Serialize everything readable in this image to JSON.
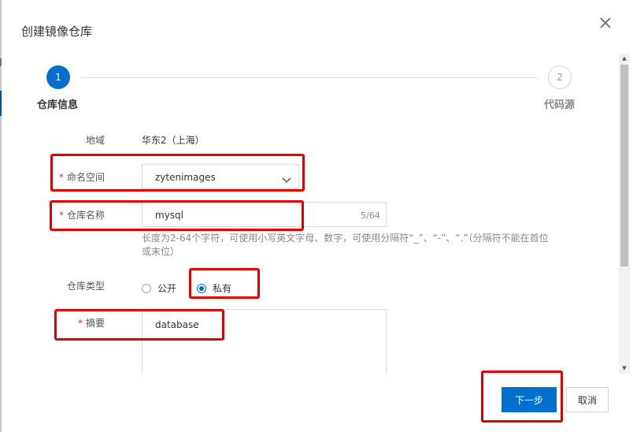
{
  "dialog": {
    "title": "创建镜像仓库",
    "close_icon": "close-icon"
  },
  "steps": [
    {
      "number": "1",
      "label": "仓库信息",
      "state": "active"
    },
    {
      "number": "2",
      "label": "代码源",
      "state": "pending"
    }
  ],
  "form": {
    "region": {
      "label": "地域",
      "value": "华东2（上海）"
    },
    "namespace": {
      "required": "*",
      "label": "命名空间",
      "value": "zytenimages",
      "icon": "chevron-down-icon"
    },
    "repo_name": {
      "required": "*",
      "label": "仓库名称",
      "value": "mysql",
      "counter": "5/64",
      "hint": "长度为2-64个字符，可使用小写英文字母、数字，可使用分隔符“_”、“-”、“.”（分隔符不能在首位或末位）"
    },
    "repo_type": {
      "label": "仓库类型",
      "options": [
        {
          "label": "公开",
          "checked": false
        },
        {
          "label": "私有",
          "checked": true
        }
      ]
    },
    "summary": {
      "required": "*",
      "label": "摘要",
      "value": "database"
    }
  },
  "footer": {
    "next_label": "下一步",
    "cancel_label": "取消"
  },
  "colors": {
    "primary": "#0070cc",
    "required": "#e62e2e",
    "highlight": "#e00000"
  }
}
